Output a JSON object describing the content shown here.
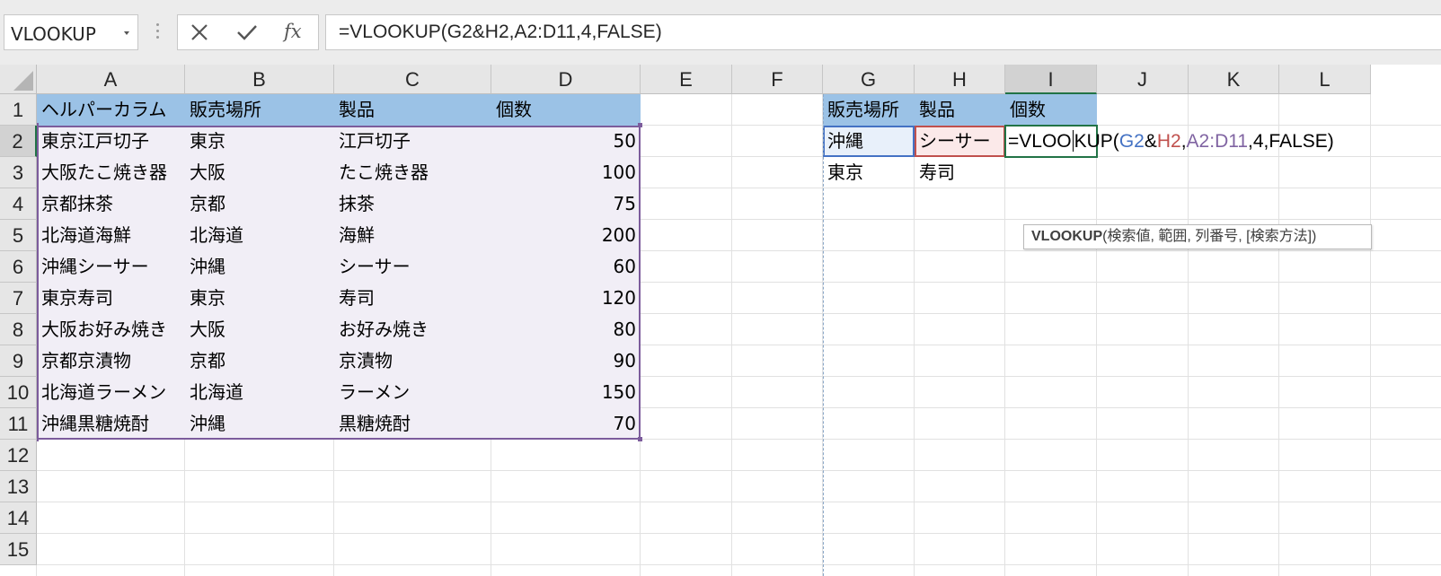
{
  "name_box": {
    "value": "VLOOKUP"
  },
  "formula_bar": {
    "cancel_icon": "x-icon",
    "enter_icon": "check-icon",
    "fx_label": "fx",
    "formula": "=VLOOKUP(G2&H2,A2:D11,4,FALSE)"
  },
  "columns": [
    "A",
    "B",
    "C",
    "D",
    "E",
    "F",
    "G",
    "H",
    "I",
    "J",
    "K",
    "L"
  ],
  "rows": [
    "1",
    "2",
    "3",
    "4",
    "5",
    "6",
    "7",
    "8",
    "9",
    "10",
    "11",
    "12",
    "13",
    "14",
    "15"
  ],
  "active_column": "I",
  "active_row": "2",
  "table": {
    "headers": [
      "ヘルパーカラム",
      "販売場所",
      "製品",
      "個数"
    ],
    "rows": [
      [
        "東京江戸切子",
        "東京",
        "江戸切子",
        "50"
      ],
      [
        "大阪たこ焼き器",
        "大阪",
        "たこ焼き器",
        "100"
      ],
      [
        "京都抹茶",
        "京都",
        "抹茶",
        "75"
      ],
      [
        "北海道海鮮",
        "北海道",
        "海鮮",
        "200"
      ],
      [
        "沖縄シーサー",
        "沖縄",
        "シーサー",
        "60"
      ],
      [
        "東京寿司",
        "東京",
        "寿司",
        "120"
      ],
      [
        "大阪お好み焼き",
        "大阪",
        "お好み焼き",
        "80"
      ],
      [
        "京都京漬物",
        "京都",
        "京漬物",
        "90"
      ],
      [
        "北海道ラーメン",
        "北海道",
        "ラーメン",
        "150"
      ],
      [
        "沖縄黒糖焼酎",
        "沖縄",
        "黒糖焼酎",
        "70"
      ]
    ]
  },
  "lookup": {
    "headers": [
      "販売場所",
      "製品",
      "個数"
    ],
    "row2": [
      "沖縄",
      "シーサー"
    ],
    "row3": [
      "東京",
      "寿司"
    ]
  },
  "editing": {
    "prefix": "=VLOO",
    "after_caret": "KUP(",
    "ref_g": "G2",
    "amp": "&",
    "ref_h": "H2",
    "comma1": ",",
    "ref_a": "A2:D11",
    "tail": ",4,FALSE)"
  },
  "tooltip": {
    "func": "VLOOKUP",
    "args": "(検索値, 範囲, 列番号, [検索方法])"
  },
  "colors": {
    "header_fill": "#9bc2e6",
    "range_border": "#7c5c9c",
    "ref_g": "#4472c4",
    "ref_h": "#c0504d",
    "accent": "#217346"
  }
}
